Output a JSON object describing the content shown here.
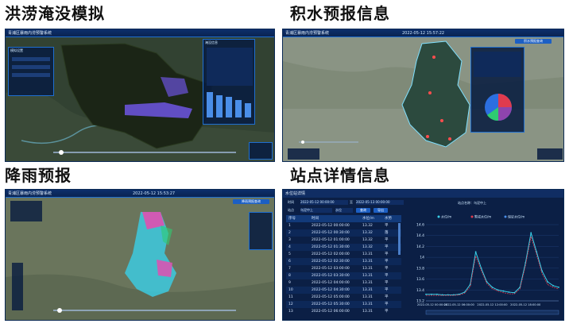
{
  "panels": {
    "flood": {
      "title": "洪涝淹没模拟"
    },
    "waterlog": {
      "title": "积水预报信息"
    },
    "rain": {
      "title": "降雨预报"
    },
    "station": {
      "title": "站点详情信息"
    }
  },
  "colors": {
    "header_bg": "#0c2f6b",
    "accent_blue": "#1f6fd1",
    "panel_bg": "#081c40",
    "map_dark": "#1c2a1c",
    "flood_purple": "#7a5cff",
    "rain_pink": "#e04fb0",
    "rain_cyan": "#39d0e8",
    "series_cyan": "#39d0e8",
    "series_red": "#e03b4e"
  },
  "flood_screen": {
    "header_title": "青浦区暴雨内涝预警系统",
    "side_panel_title": "模拟设置",
    "info_panel_title": "淹没信息"
  },
  "waterlog_screen": {
    "header_title": "青浦区暴雨内涝预警系统",
    "header_time": "2022-05-12 15:57:22",
    "button_label": "积水预报查询"
  },
  "rain_screen": {
    "header_title": "青浦区暴雨内涝预警系统",
    "header_time": "2022-05-12 15:53:27",
    "button_label": "降雨预报查询"
  },
  "station_screen": {
    "window_title": "水位站详情",
    "time_label": "时间",
    "time_start": "2022-05-12 00:00:00",
    "time_separator": "至",
    "time_end": "2022-05-13 00:00:00",
    "station_label": "站点",
    "station_value": "乌泥中上",
    "type_value": "水位",
    "query_button": "查询",
    "export_button": "导出",
    "chart_station_label": "站点名称：乌泥中上",
    "columns": [
      "序号",
      "时间",
      "水位/m",
      "水势"
    ],
    "rows": [
      [
        "1",
        "2022-05-12 00:00:00",
        "13.32",
        "平"
      ],
      [
        "2",
        "2022-05-12 00:30:00",
        "13.32",
        "落"
      ],
      [
        "3",
        "2022-05-12 01:00:00",
        "13.32",
        "平"
      ],
      [
        "4",
        "2022-05-12 01:30:00",
        "13.32",
        "平"
      ],
      [
        "5",
        "2022-05-12 02:00:00",
        "13.31",
        "平"
      ],
      [
        "6",
        "2022-05-12 02:30:00",
        "13.31",
        "平"
      ],
      [
        "7",
        "2022-05-12 03:00:00",
        "13.31",
        "平"
      ],
      [
        "8",
        "2022-05-12 03:30:00",
        "13.31",
        "平"
      ],
      [
        "9",
        "2022-05-12 04:00:00",
        "13.31",
        "平"
      ],
      [
        "10",
        "2022-05-12 04:30:00",
        "13.31",
        "平"
      ],
      [
        "11",
        "2022-05-12 05:00:00",
        "13.31",
        "平"
      ],
      [
        "12",
        "2022-05-12 05:30:00",
        "13.31",
        "平"
      ],
      [
        "13",
        "2022-05-12 06:00:00",
        "13.31",
        "平"
      ]
    ]
  },
  "chart_data": {
    "type": "line",
    "title": "",
    "legend": [
      "水位/m",
      "警戒水位/m",
      "保证水位/m"
    ],
    "legend_position": "top-right",
    "ylim": [
      13.2,
      14.6
    ],
    "yticks": [
      13.2,
      13.4,
      13.6,
      13.8,
      14.0,
      14.2,
      14.4,
      14.6
    ],
    "xtick_labels": [
      "2022-05-12 00:00:00",
      "2022-05-12 06:00:00",
      "2022-05-12 12:00:00",
      "2022-05-12 18:00:00"
    ],
    "grid": true,
    "series": [
      {
        "name": "水位/m",
        "color": "#39d0e8",
        "x": [
          0,
          1,
          2,
          3,
          4,
          5,
          6,
          7,
          8,
          9,
          10,
          11,
          12,
          13,
          14,
          15,
          16,
          17,
          18,
          19,
          20,
          21,
          22,
          23,
          24
        ],
        "values": [
          13.32,
          13.32,
          13.32,
          13.31,
          13.31,
          13.31,
          13.32,
          13.36,
          13.5,
          14.1,
          13.8,
          13.55,
          13.45,
          13.4,
          13.38,
          13.36,
          13.35,
          13.45,
          13.9,
          14.45,
          14.1,
          13.75,
          13.55,
          13.48,
          13.45
        ]
      },
      {
        "name": "警戒水位/m",
        "color": "#e03b4e",
        "x": [
          0,
          1,
          2,
          3,
          4,
          5,
          6,
          7,
          8,
          9,
          10,
          11,
          12,
          13,
          14,
          15,
          16,
          17,
          18,
          19,
          20,
          21,
          22,
          23,
          24
        ],
        "values": [
          13.3,
          13.3,
          13.3,
          13.3,
          13.3,
          13.3,
          13.31,
          13.34,
          13.46,
          14.02,
          13.76,
          13.52,
          13.42,
          13.38,
          13.35,
          13.33,
          13.33,
          13.42,
          13.85,
          14.38,
          14.05,
          13.7,
          13.5,
          13.45,
          13.42
        ]
      }
    ]
  }
}
